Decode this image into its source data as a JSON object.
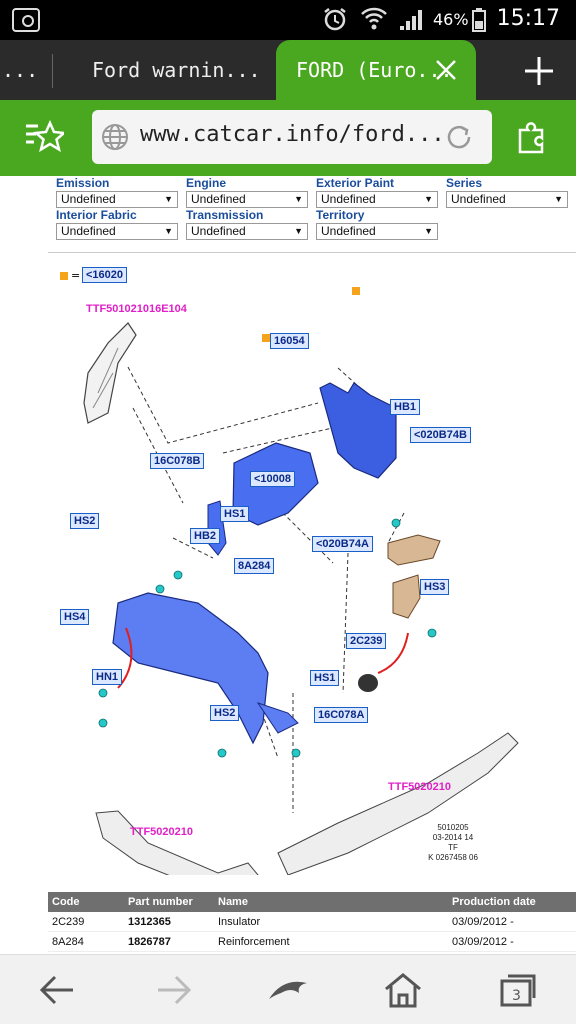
{
  "status": {
    "battery_percent": "46%",
    "time": "15:17"
  },
  "tabs": [
    {
      "label": "..."
    },
    {
      "label": "Ford warnin..."
    },
    {
      "label": "FORD (Euro..."
    }
  ],
  "url": "www.catcar.info/ford...",
  "filters": [
    {
      "label": "Emission",
      "value": "Undefined"
    },
    {
      "label": "Engine",
      "value": "Undefined"
    },
    {
      "label": "Exterior Paint",
      "value": "Undefined"
    },
    {
      "label": "Series",
      "value": "Undefined"
    },
    {
      "label": "Interior Fabric",
      "value": "Undefined"
    },
    {
      "label": "Transmission",
      "value": "Undefined"
    },
    {
      "label": "Territory",
      "value": "Undefined"
    }
  ],
  "diagram": {
    "legend": {
      "eq": "=",
      "code": "<16020"
    },
    "callouts": {
      "c16054": "16054",
      "c10008": "<10008",
      "c16C078B": "16C078B",
      "cHS1a": "HS1",
      "cHB2": "HB2",
      "cHS2a": "HS2",
      "cHB1": "HB1",
      "c020B74B": "<020B74B",
      "c020B74A": "<020B74A",
      "cHS3": "HS3",
      "c8A284": "8A284",
      "cHS4": "HS4",
      "cHN1": "HN1",
      "c2C239": "2C239",
      "cHS1b": "HS1",
      "cHS2b": "HS2",
      "c16C078A": "16C078A"
    },
    "magenta_labels": {
      "m1": "TTF501021016E104",
      "m2": "TTF5020210",
      "m3": "TTF5020210"
    },
    "stamp": [
      "5010205",
      "03-2014 14",
      "TF",
      "K 0267458 06"
    ]
  },
  "table": {
    "headers": [
      "Code",
      "Part number",
      "Name",
      "Production date"
    ],
    "rows": [
      [
        "2C239",
        "1312365",
        "Insulator",
        "03/09/2012 -"
      ],
      [
        "8A284",
        "1826787",
        "Reinforcement",
        "03/09/2012 -"
      ]
    ]
  }
}
